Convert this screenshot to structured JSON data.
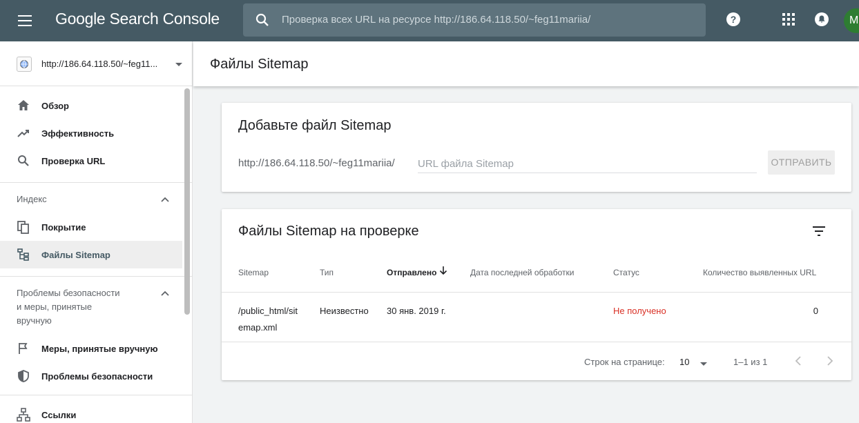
{
  "app": {
    "title": "Google Search Console",
    "search_placeholder": "Проверка всех URL на ресурсе http://186.64.118.50/~feg11mariia/",
    "avatar_letter": "M",
    "avatar_color": "#2e7d32",
    "topbar_color": "#455a64"
  },
  "sidebar": {
    "property_label": "http://186.64.118.50/~feg11...",
    "items_top": [
      {
        "label": "Обзор",
        "icon": "home-icon"
      },
      {
        "label": "Эффективность",
        "icon": "trending-up-icon"
      },
      {
        "label": "Проверка URL",
        "icon": "search-icon"
      }
    ],
    "index_section": {
      "label": "Индекс",
      "items": [
        {
          "label": "Покрытие",
          "icon": "coverage-icon"
        },
        {
          "label": "Файлы Sitemap",
          "icon": "sitemap-icon",
          "active": true
        }
      ]
    },
    "security_section": {
      "label_line1": "Проблемы безопасности",
      "label_line2": "и меры, принятые",
      "label_line3": "вручную",
      "items": [
        {
          "label": "Меры, принятые вручную",
          "icon": "flag-icon"
        },
        {
          "label": "Проблемы безопасности",
          "icon": "shield-icon"
        }
      ]
    },
    "links_item": {
      "label": "Ссылки",
      "icon": "links-icon"
    }
  },
  "main": {
    "page_title": "Файлы Sitemap",
    "add_card": {
      "title": "Добавьте файл Sitemap",
      "url_prefix": "http://186.64.118.50/~feg11mariia/",
      "input_placeholder": "URL файла Sitemap",
      "submit_label": "ОТПРАВИТЬ"
    },
    "list_card": {
      "title": "Файлы Sitemap на проверке",
      "columns": [
        "Sitemap",
        "Тип",
        "Отправлено",
        "Дата последней обработки",
        "Статус",
        "Количество выявленных URL"
      ],
      "rows": [
        {
          "sitemap_line1": "/public_html/sit",
          "sitemap_line2": "emap.xml",
          "type": "Неизвестно",
          "submitted": "30 янв. 2019 г.",
          "last_read": "",
          "status": "Не получено",
          "discovered_urls": "0"
        }
      ],
      "pagination": {
        "rows_label": "Строк на странице:",
        "rows_per_page": "10",
        "range": "1–1 из 1"
      }
    }
  }
}
